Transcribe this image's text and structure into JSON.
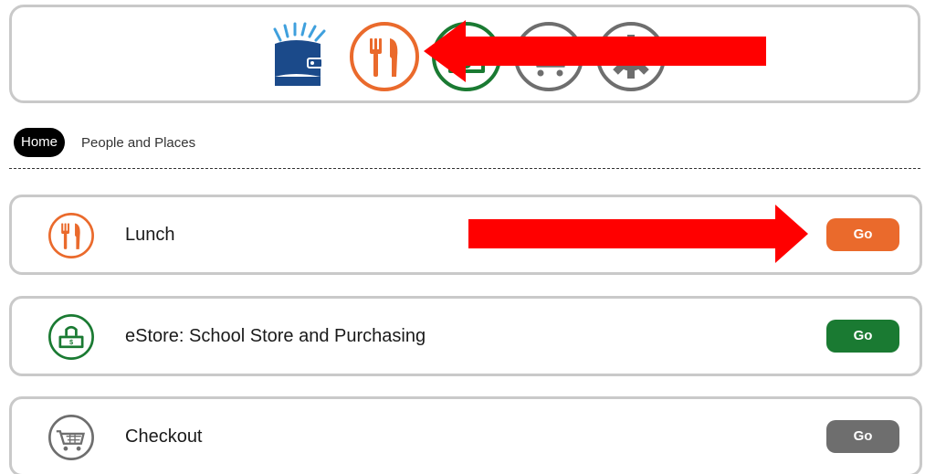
{
  "nav": {
    "icons": [
      {
        "name": "library-book-icon",
        "color": "#1b4a8a"
      },
      {
        "name": "lunch-icon",
        "color": "#ea6a2c"
      },
      {
        "name": "estore-money-icon",
        "color": "#1a7a32"
      },
      {
        "name": "checkout-cart-icon",
        "color": "#6e6e6e"
      },
      {
        "name": "settings-gear-icon",
        "color": "#6e6e6e"
      }
    ]
  },
  "breadcrumb": {
    "home": "Home",
    "people": "People and Places"
  },
  "cards": [
    {
      "title": "Lunch",
      "go": "Go",
      "icon": "lunch-icon",
      "color": "#ea6a2c"
    },
    {
      "title": "eStore: School Store and Purchasing",
      "go": "Go",
      "icon": "estore-money-icon",
      "color": "#1a7a32"
    },
    {
      "title": "Checkout",
      "go": "Go",
      "icon": "checkout-cart-icon",
      "color": "#6e6e6e"
    }
  ],
  "annotations": {
    "arrow_color": "#ff0000"
  }
}
